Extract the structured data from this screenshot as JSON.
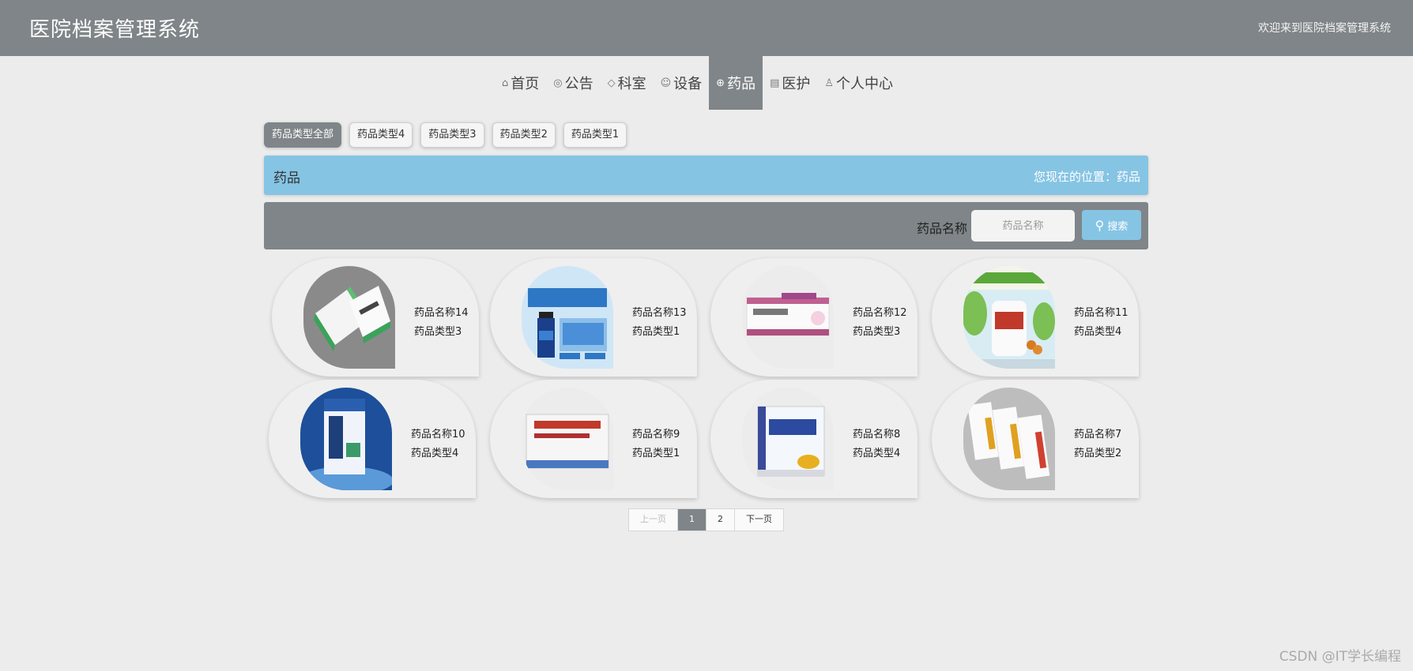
{
  "header": {
    "site_title": "医院档案管理系统",
    "welcome": "欢迎来到医院档案管理系统"
  },
  "nav": [
    {
      "label": "首页",
      "icon": "home-icon",
      "active": false
    },
    {
      "label": "公告",
      "icon": "palette-icon",
      "active": false
    },
    {
      "label": "科室",
      "icon": "tag-icon",
      "active": false
    },
    {
      "label": "设备",
      "icon": "smile-icon",
      "active": false
    },
    {
      "label": "药品",
      "icon": "globe-icon",
      "active": true
    },
    {
      "label": "医护",
      "icon": "clipboard-icon",
      "active": false
    },
    {
      "label": "个人中心",
      "icon": "user-icon",
      "active": false
    }
  ],
  "filters": [
    {
      "label": "药品类型全部",
      "active": true
    },
    {
      "label": "药品类型4",
      "active": false
    },
    {
      "label": "药品类型3",
      "active": false
    },
    {
      "label": "药品类型2",
      "active": false
    },
    {
      "label": "药品类型1",
      "active": false
    }
  ],
  "band": {
    "title": "药品",
    "location": "您现在的位置：药品"
  },
  "search": {
    "label": "药品名称",
    "placeholder": "药品名称",
    "button": "搜索"
  },
  "items": [
    {
      "name": "药品名称14",
      "type": "药品类型3",
      "accent": "#3aa35a"
    },
    {
      "name": "药品名称13",
      "type": "药品类型1",
      "accent": "#2a5fb8"
    },
    {
      "name": "药品名称12",
      "type": "药品类型3",
      "accent": "#c06090"
    },
    {
      "name": "药品名称11",
      "type": "药品类型4",
      "accent": "#5aa83a"
    },
    {
      "name": "药品名称10",
      "type": "药品类型4",
      "accent": "#1d4f9a"
    },
    {
      "name": "药品名称9",
      "type": "药品类型1",
      "accent": "#c0392b"
    },
    {
      "name": "药品名称8",
      "type": "药品类型4",
      "accent": "#2c4aa0"
    },
    {
      "name": "药品名称7",
      "type": "药品类型2",
      "accent": "#e0a020"
    }
  ],
  "pagination": {
    "prev": "上一页",
    "pages": [
      "1",
      "2"
    ],
    "current": "1",
    "next": "下一页"
  },
  "watermark": "CSDN @IT学长编程"
}
